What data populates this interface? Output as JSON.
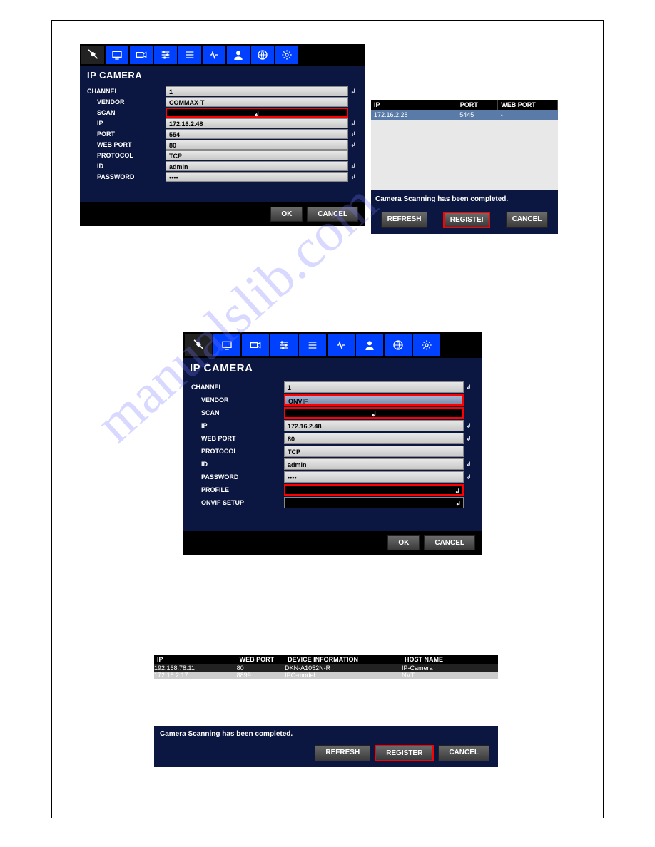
{
  "watermark": "manualslib.com",
  "window1": {
    "title": "IP CAMERA",
    "fields": {
      "channel_label": "CHANNEL",
      "channel_value": "1",
      "vendor_label": "VENDOR",
      "vendor_value": "COMMAX-T",
      "scan_label": "SCAN",
      "scan_value": "↲",
      "ip_label": "IP",
      "ip_value": "172.16.2.48",
      "port_label": "PORT",
      "port_value": "554",
      "webport_label": "WEB PORT",
      "webport_value": "80",
      "protocol_label": "PROTOCOL",
      "protocol_value": "TCP",
      "id_label": "ID",
      "id_value": "admin",
      "password_label": "PASSWORD",
      "password_value": "••••"
    },
    "ok": "OK",
    "cancel": "CANCEL"
  },
  "scan1": {
    "headers": {
      "ip": "IP",
      "port": "PORT",
      "webport": "WEB PORT"
    },
    "rows": [
      {
        "ip": "172.16.2.28",
        "port": "5445",
        "webport": "-"
      }
    ],
    "status": "Camera Scanning has been completed.",
    "refresh": "REFRESH",
    "register": "REGISTEI",
    "cancel": "CANCEL"
  },
  "window2": {
    "title": "IP CAMERA",
    "fields": {
      "channel_label": "CHANNEL",
      "channel_value": "1",
      "vendor_label": "VENDOR",
      "vendor_value": "ONVIF",
      "scan_label": "SCAN",
      "scan_value": "↲",
      "ip_label": "IP",
      "ip_value": "172.16.2.48",
      "webport_label": "WEB PORT",
      "webport_value": "80",
      "protocol_label": "PROTOCOL",
      "protocol_value": "TCP",
      "id_label": "ID",
      "id_value": "admin",
      "password_label": "PASSWORD",
      "password_value": "••••",
      "profile_label": "PROFILE",
      "profile_value": "",
      "onvif_label": "ONVIF SETUP",
      "onvif_value": "↲"
    },
    "ok": "OK",
    "cancel": "CANCEL"
  },
  "scan3": {
    "headers": {
      "ip": "IP",
      "webport": "WEB PORT",
      "device": "DEVICE INFORMATION",
      "host": "HOST NAME"
    },
    "rows": [
      {
        "ip": "192.168.78.11",
        "webport": "80",
        "device": "DKN-A1052N-R",
        "host": "IP-Camera"
      },
      {
        "ip": "172.16.2.17",
        "webport": "8899",
        "device": "IPC-model",
        "host": "NVT"
      }
    ],
    "status": "Camera Scanning has been completed.",
    "refresh": "REFRESH",
    "register": "REGISTER",
    "cancel": "CANCEL"
  }
}
